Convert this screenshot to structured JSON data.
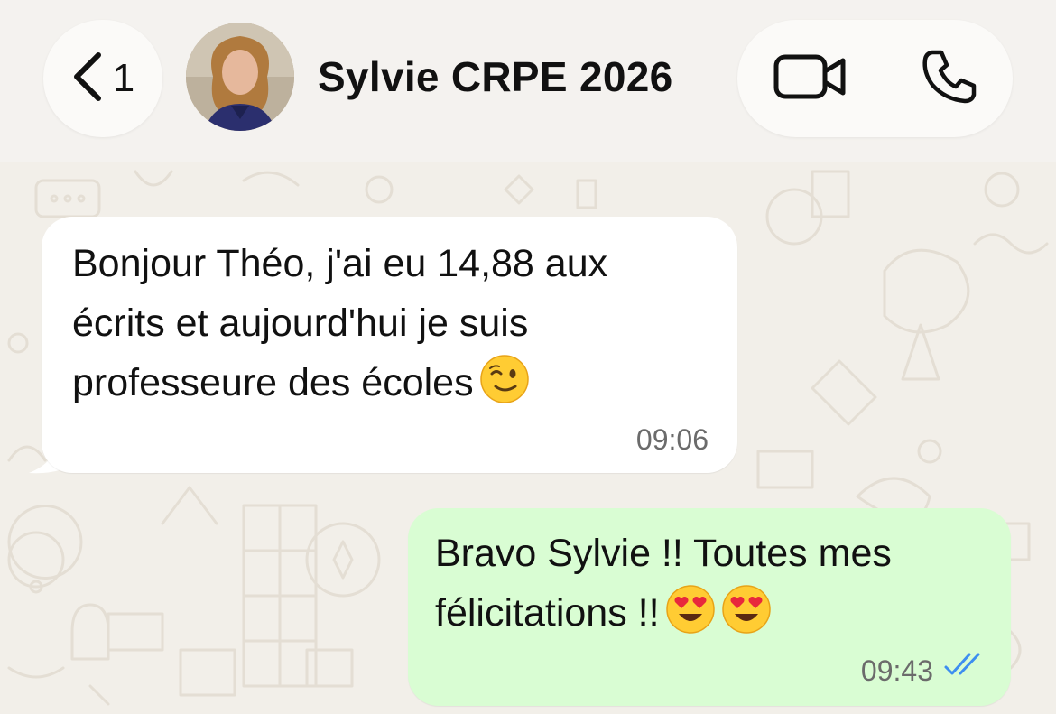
{
  "header": {
    "back_count": "1",
    "contact_name": "Sylvie CRPE 2026"
  },
  "messages": [
    {
      "direction": "incoming",
      "text": "Bonjour Théo, j'ai eu 14,88 aux\nécrits et aujourd'hui je suis\nprofesseure des écoles",
      "emoji": [
        "winking-face"
      ],
      "time": "09:06"
    },
    {
      "direction": "outgoing",
      "text": "Bravo Sylvie !! Toutes mes\nfélicitations !!",
      "emoji": [
        "smiling-face-with-heart-eyes",
        "smiling-face-with-heart-eyes"
      ],
      "time": "09:43",
      "status": "read"
    }
  ],
  "icons": {
    "back": "chevron-left-icon",
    "video": "video-camera-icon",
    "call": "phone-icon",
    "read_status": "double-check-icon"
  },
  "colors": {
    "incoming_bubble": "#ffffff",
    "outgoing_bubble": "#d9fdd3",
    "read_ticks": "#3d8ef0",
    "chat_background": "#f2efe9"
  }
}
